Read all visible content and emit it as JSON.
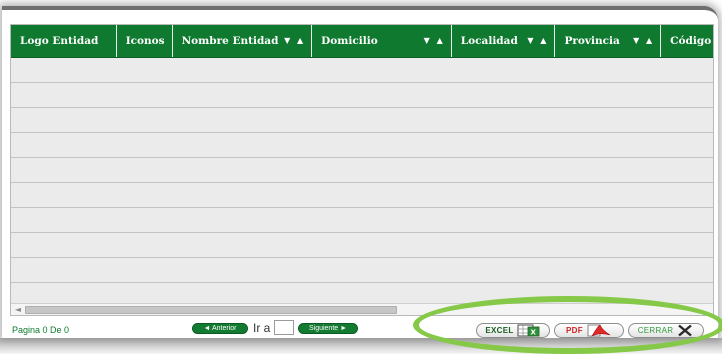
{
  "grid": {
    "columns": [
      {
        "label": "Logo Entidad",
        "sortable": false
      },
      {
        "label": "Iconos",
        "sortable": false
      },
      {
        "label": "Nombre Entidad",
        "sortable": true
      },
      {
        "label": "Domicilio",
        "sortable": true
      },
      {
        "label": "Localidad",
        "sortable": true
      },
      {
        "label": "Provincia",
        "sortable": true
      },
      {
        "label": "Código",
        "sortable": false
      }
    ],
    "sort_glyph": "▼ ▲",
    "row_count": 10
  },
  "pager": {
    "page_info": "Pagina 0 De 0",
    "prev_label": "◄ Anterior",
    "goto_label": "Ir a",
    "goto_value": "",
    "next_label": "Siguiente ►"
  },
  "export": {
    "excel_label": "EXCEL",
    "pdf_label": "PDF",
    "close_label": "CERRAR"
  },
  "colors": {
    "header_green": "#0f7a2f",
    "highlight_ring": "#86c847",
    "excel_text": "#1a5e20",
    "pdf_text": "#d42020",
    "close_text": "#2f9a3c"
  }
}
